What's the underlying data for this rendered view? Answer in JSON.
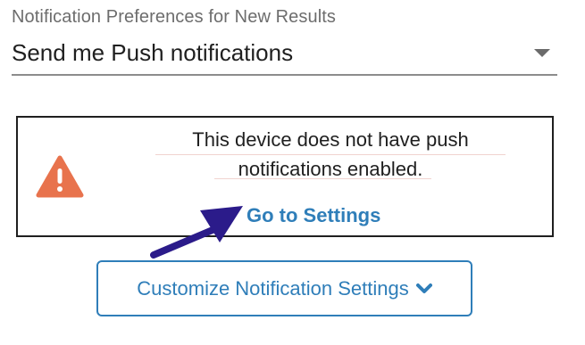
{
  "notification_preferences": {
    "label": "Notification Preferences for New Results",
    "selected_value": "Send me Push notifications"
  },
  "push_warning": {
    "icon": "warning-icon",
    "message_line_1": "This device does not have push",
    "message_line_2": "notifications enabled.",
    "link_label": "Go to Settings",
    "colors": {
      "icon": "#E8734D",
      "link": "#2F7EB9",
      "annotation_arrow": "#2B1B8A"
    }
  },
  "customize_button": {
    "label": "Customize Notification Settings",
    "icon": "chevron-down-icon"
  }
}
